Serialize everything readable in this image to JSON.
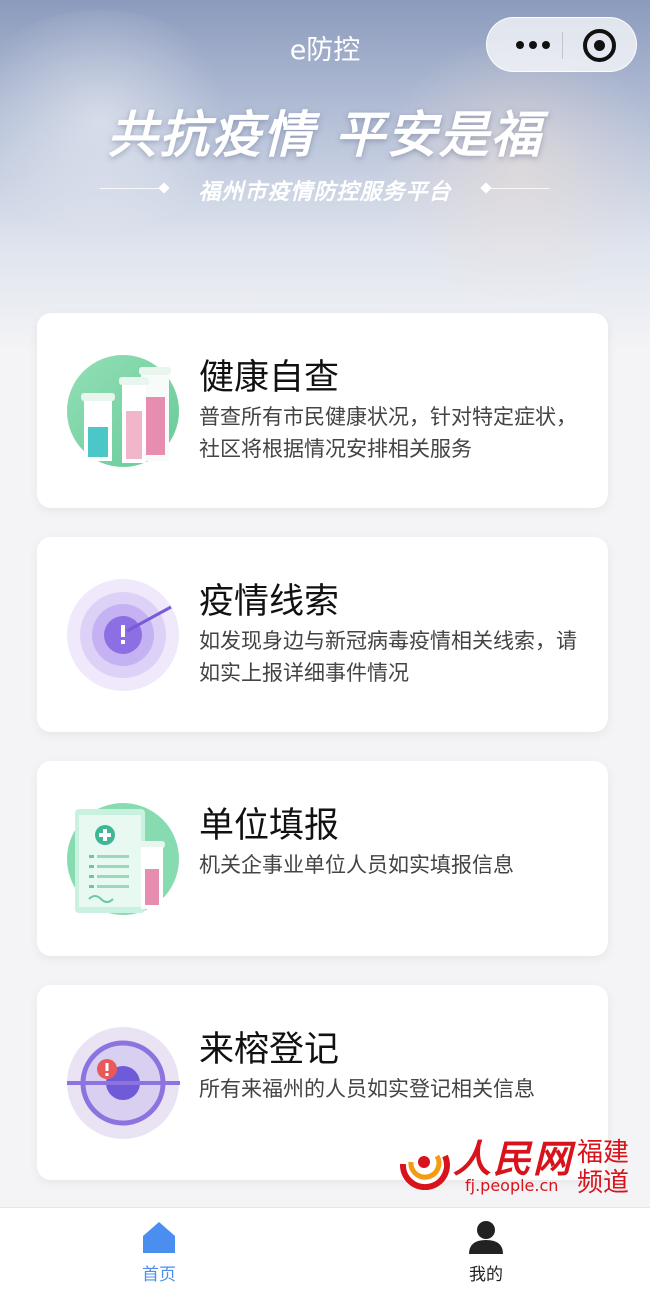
{
  "nav": {
    "title": "e防控"
  },
  "hero": {
    "slogan": "共抗疫情  平安是福",
    "subtitle": "福州市疫情防控服务平台"
  },
  "cards": [
    {
      "title": "健康自查",
      "desc": "普查所有市民健康状况，针对特定症状，社区将根据情况安排相关服务",
      "icon": "test-tubes-icon"
    },
    {
      "title": "疫情线索",
      "desc": "如发现身边与新冠病毒疫情相关线索，请如实上报详细事件情况",
      "icon": "radar-alert-icon"
    },
    {
      "title": "单位填报",
      "desc": "机关企事业单位人员如实填报信息",
      "icon": "medical-form-icon"
    },
    {
      "title": "来榕登记",
      "desc": "所有来福州的人员如实登记相关信息",
      "icon": "target-alert-icon"
    }
  ],
  "watermark": {
    "brand": "人民网",
    "url": "fj.people.cn",
    "channel_line1": "福建",
    "channel_line2": "频道"
  },
  "tabbar": [
    {
      "label": "首页",
      "icon": "home-icon",
      "active": true
    },
    {
      "label": "我的",
      "icon": "user-icon",
      "active": false
    }
  ],
  "colors": {
    "tab_active": "#4a8ef0",
    "tab_inactive": "#222222",
    "brand_red": "#d8131b"
  }
}
